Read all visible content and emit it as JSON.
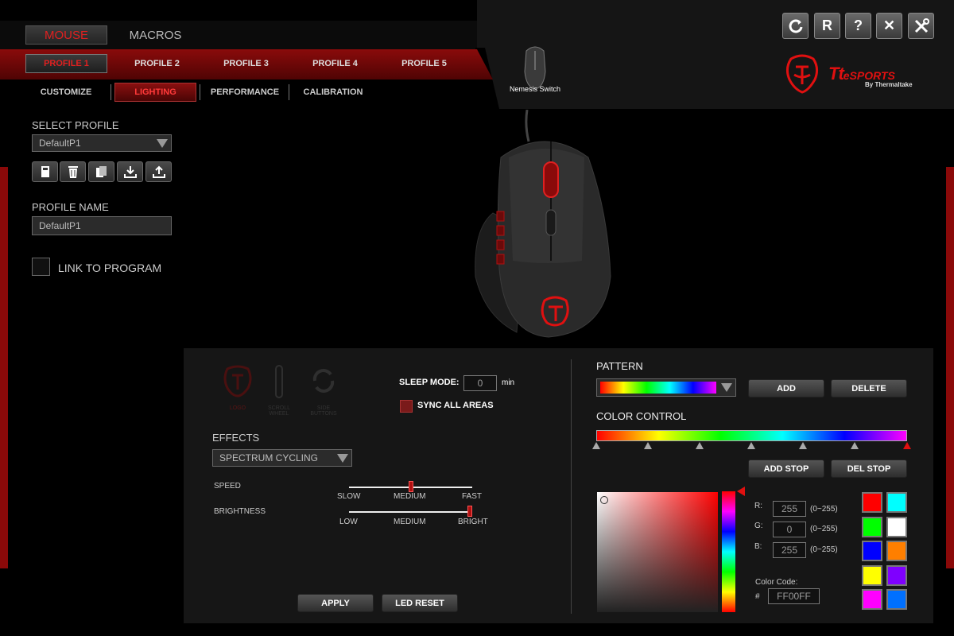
{
  "window": {
    "buttons": [
      {
        "name": "refresh-icon",
        "glyph": "↻"
      },
      {
        "name": "reset-icon",
        "glyph": "R"
      },
      {
        "name": "help-icon",
        "glyph": "?"
      },
      {
        "name": "close-icon",
        "glyph": "✕"
      },
      {
        "name": "tools-icon",
        "glyph": "⚒"
      }
    ]
  },
  "modes": {
    "mouse": "MOUSE",
    "macros": "MACROS"
  },
  "profiles": [
    "PROFILE 1",
    "PROFILE 2",
    "PROFILE 3",
    "PROFILE 4",
    "PROFILE 5"
  ],
  "subtabs": [
    "CUSTOMIZE",
    "LIGHTING",
    "PERFORMANCE",
    "CALIBRATION"
  ],
  "device": {
    "name": "Nemesis Switch"
  },
  "brand": {
    "main": "Tt",
    "sub": "eSPORTS",
    "by": "By Thermaltake"
  },
  "sidebar": {
    "select_profile_label": "SELECT PROFILE",
    "selected_profile": "DefaultP1",
    "profile_name_label": "PROFILE NAME",
    "profile_name_value": "DefaultP1",
    "link_label": "LINK TO PROGRAM"
  },
  "zones": {
    "logo": "LOGO",
    "scroll": "SCROLL WHEEL",
    "side": "SIDE BUTTONS"
  },
  "sleep": {
    "label": "SLEEP MODE:",
    "value": "0",
    "unit": "min"
  },
  "sync_label": "SYNC ALL AREAS",
  "effects": {
    "label": "EFFECTS",
    "selected": "SPECTRUM CYCLING",
    "speed_label": "SPEED",
    "speed_ticks": [
      "SLOW",
      "MEDIUM",
      "FAST"
    ],
    "speed_level": 0.5,
    "brightness_label": "BRIGHTNESS",
    "brightness_ticks": [
      "LOW",
      "MEDIUM",
      "BRIGHT"
    ],
    "brightness_level": 1.0
  },
  "actions": {
    "apply": "APPLY",
    "led_reset": "LED RESET"
  },
  "pattern": {
    "label": "PATTERN",
    "add": "ADD",
    "delete": "DELETE"
  },
  "color_control": {
    "label": "COLOR CONTROL",
    "add_stop": "ADD STOP",
    "del_stop": "DEL STOP"
  },
  "rgb": {
    "r_label": "R:",
    "r_value": "255",
    "g_label": "G:",
    "g_value": "0",
    "b_label": "B:",
    "b_value": "255",
    "range": "(0~255)",
    "code_label": "Color Code:",
    "hash": "#",
    "code_value": "FF00FF"
  },
  "swatches": [
    "#ff0000",
    "#00ffff",
    "#00ff00",
    "#ffffff",
    "#0000ff",
    "#ff7f00",
    "#ffff00",
    "#7f00ff",
    "#ff00ff",
    "#0070ff"
  ],
  "colors": {
    "accent": "#e01010",
    "panel": "#161616"
  }
}
